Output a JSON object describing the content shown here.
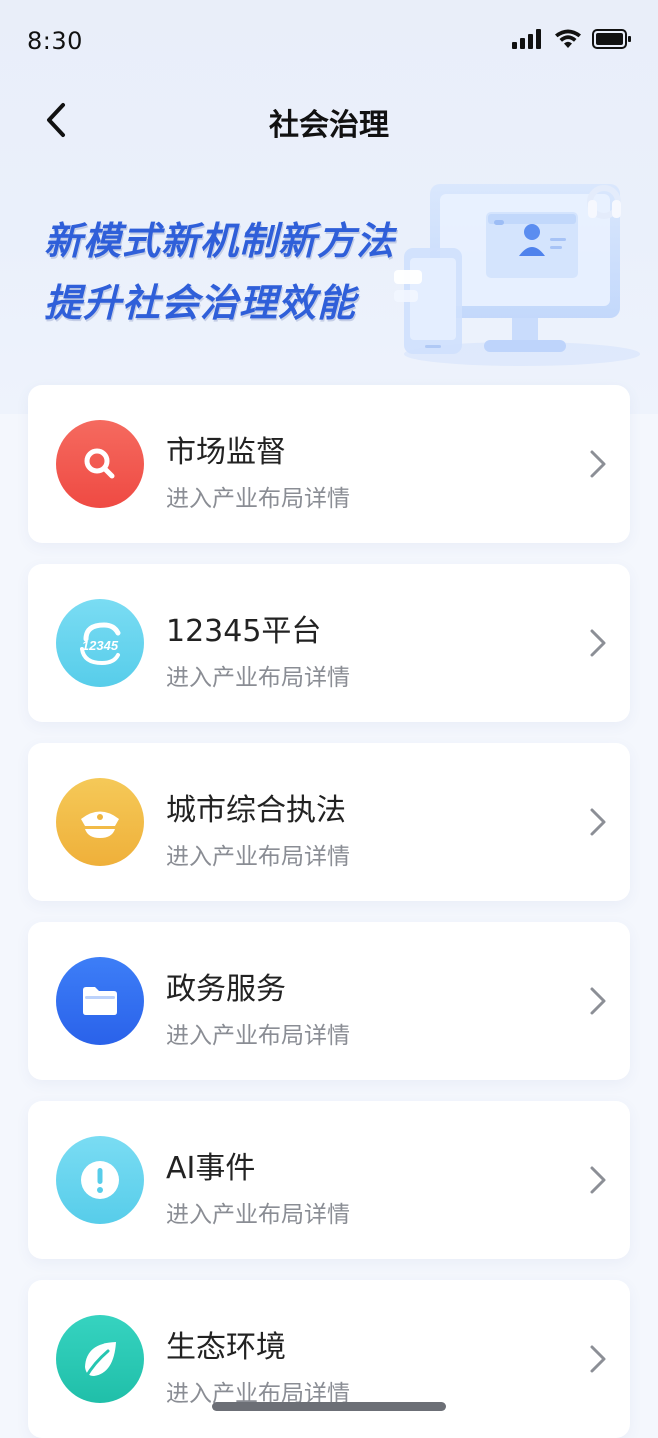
{
  "status_bar": {
    "time": "8:30"
  },
  "nav": {
    "title": "社会治理"
  },
  "banner": {
    "line1": "新模式新机制新方法",
    "line2": "提升社会治理效能"
  },
  "menu": [
    {
      "title": "市场监督",
      "subtitle": "进入产业布局详情",
      "icon": "magnifier-icon",
      "color": "#f35950"
    },
    {
      "title": "12345平台",
      "subtitle": "进入产业布局详情",
      "icon": "hotline-12345-icon",
      "icon_text": "12345",
      "color": "#5fd4ef"
    },
    {
      "title": "城市综合执法",
      "subtitle": "进入产业布局详情",
      "icon": "police-cap-icon",
      "color": "#f2bd45"
    },
    {
      "title": "政务服务",
      "subtitle": "进入产业布局详情",
      "icon": "folder-icon",
      "color": "#2f6ef2"
    },
    {
      "title": "AI事件",
      "subtitle": "进入产业布局详情",
      "icon": "exclamation-icon",
      "color": "#5fd4ef"
    },
    {
      "title": "生态环境",
      "subtitle": "进入产业布局详情",
      "icon": "leaf-icon",
      "color": "#29c9b5"
    }
  ]
}
